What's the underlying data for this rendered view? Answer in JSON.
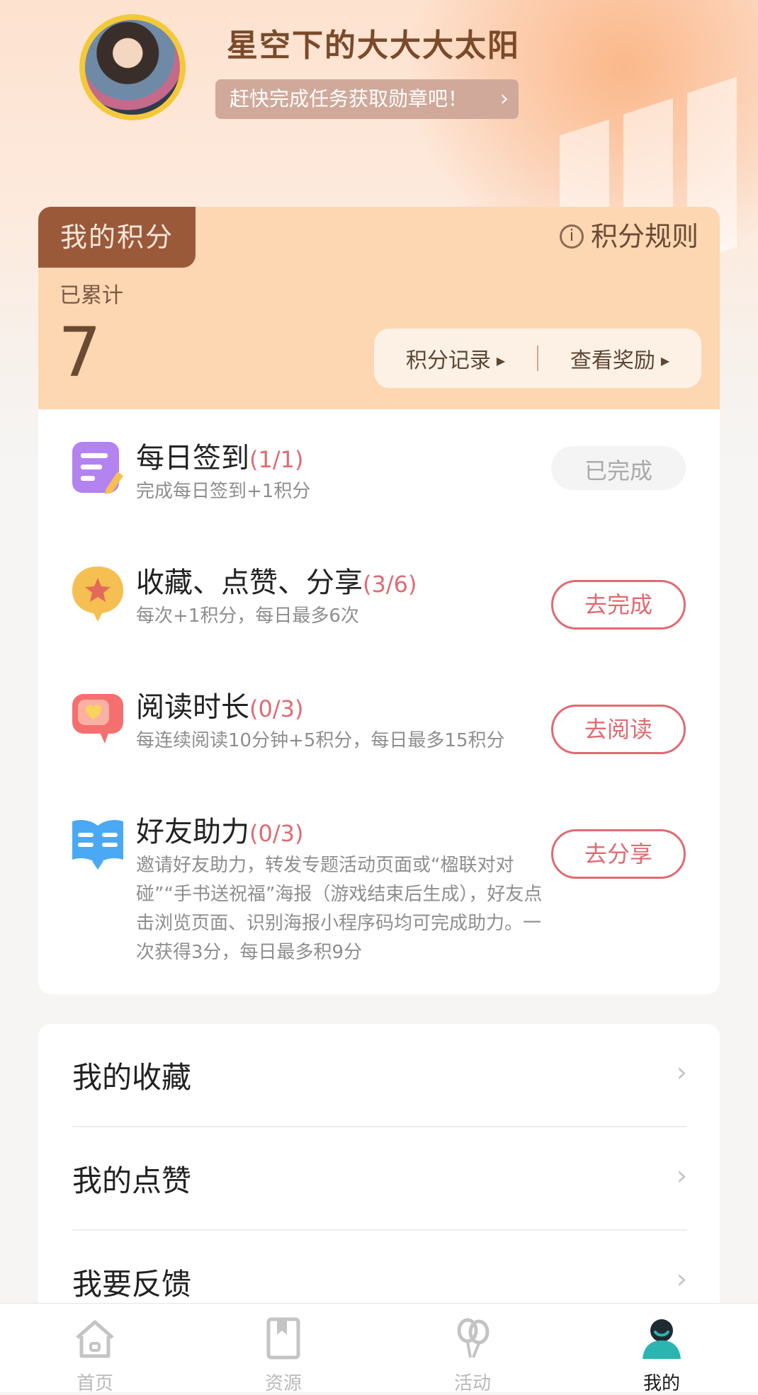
{
  "profile": {
    "username": "星空下的大大大太阳",
    "promo_text": "赶快完成任务获取勋章吧！",
    "promo_chevron": "›"
  },
  "points": {
    "tab_label": "我的积分",
    "rules_label": "积分规则",
    "accumulated_label": "已累计",
    "value": "7",
    "record_label": "积分记录",
    "reward_label": "查看奖励"
  },
  "tasks": [
    {
      "title": "每日签到",
      "progress": "(1/1)",
      "desc": "完成每日签到+1积分",
      "button": "已完成",
      "icon": "checkin-note-icon"
    },
    {
      "title": "收藏、点赞、分享",
      "progress": "(3/6)",
      "desc": "每次+1积分，每日最多6次",
      "button": "去完成",
      "icon": "star-bubble-icon"
    },
    {
      "title": "阅读时长",
      "progress": "(0/3)",
      "desc": "每连续阅读10分钟+5积分，每日最多15积分",
      "button": "去阅读",
      "icon": "heart-chat-icon"
    },
    {
      "title": "好友助力",
      "progress": "(0/3)",
      "desc": "邀请好友助力，转发专题活动页面或“楹联对对碰”“手书送祝福”海报（游戏结束后生成），好友点击浏览页面、识别海报小程序码均可完成助力。一次获得3分，每日最多积9分",
      "button": "去分享",
      "icon": "open-book-icon"
    }
  ],
  "menu": [
    {
      "label": "我的收藏"
    },
    {
      "label": "我的点赞"
    },
    {
      "label": "我要反馈"
    }
  ],
  "tabbar": [
    {
      "label": "首页",
      "icon": "home-icon"
    },
    {
      "label": "资源",
      "icon": "bookmark-icon"
    },
    {
      "label": "活动",
      "icon": "balloons-icon"
    },
    {
      "label": "我的",
      "icon": "user-icon",
      "active": true
    }
  ],
  "colors": {
    "accent": "#e06a72",
    "brown": "#9a5a3a",
    "points_card": "#fcd7b1",
    "active_tab": "#2bb5b0"
  }
}
